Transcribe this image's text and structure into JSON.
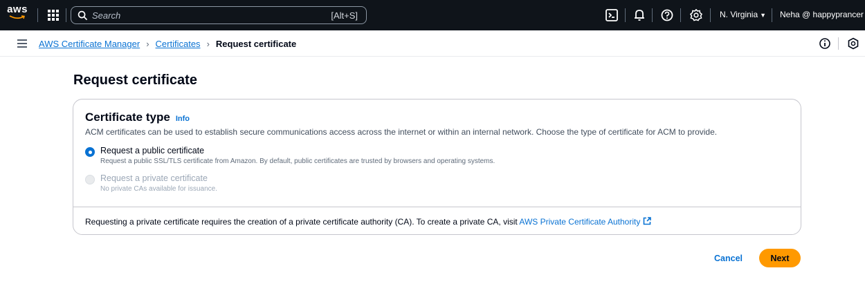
{
  "topnav": {
    "logo_text": "aws",
    "search_placeholder": "Search",
    "search_shortcut": "[Alt+S]",
    "region": "N. Virginia",
    "account": "Neha @ happyprancer",
    "icons": [
      "aws-logo-icon",
      "apps-grid-icon",
      "search-icon",
      "cloudshell-icon",
      "bell-icon",
      "help-icon",
      "settings-icon"
    ]
  },
  "breadcrumb": {
    "items": [
      {
        "label": "AWS Certificate Manager",
        "link": true
      },
      {
        "label": "Certificates",
        "link": true
      },
      {
        "label": "Request certificate",
        "link": false
      }
    ],
    "separator": "›"
  },
  "page": {
    "title": "Request certificate"
  },
  "certificate_type": {
    "title": "Certificate type",
    "info_label": "Info",
    "description": "ACM certificates can be used to establish secure communications access across the internet or within an internal network. Choose the type of certificate for ACM to provide.",
    "options": [
      {
        "label": "Request a public certificate",
        "description": "Request a public SSL/TLS certificate from Amazon. By default, public certificates are trusted by browsers and operating systems.",
        "selected": true,
        "disabled": false
      },
      {
        "label": "Request a private certificate",
        "description": "No private CAs available for issuance.",
        "selected": false,
        "disabled": true
      }
    ],
    "footer_text": "Requesting a private certificate requires the creation of a private certificate authority (CA). To create a private CA, visit ",
    "footer_link": "AWS Private Certificate Authority"
  },
  "actions": {
    "cancel_label": "Cancel",
    "next_label": "Next"
  },
  "colors": {
    "nav_bg": "#0f141a",
    "link": "#0972d3",
    "primary_button": "#ff9900",
    "border": "#c6c6cd"
  }
}
